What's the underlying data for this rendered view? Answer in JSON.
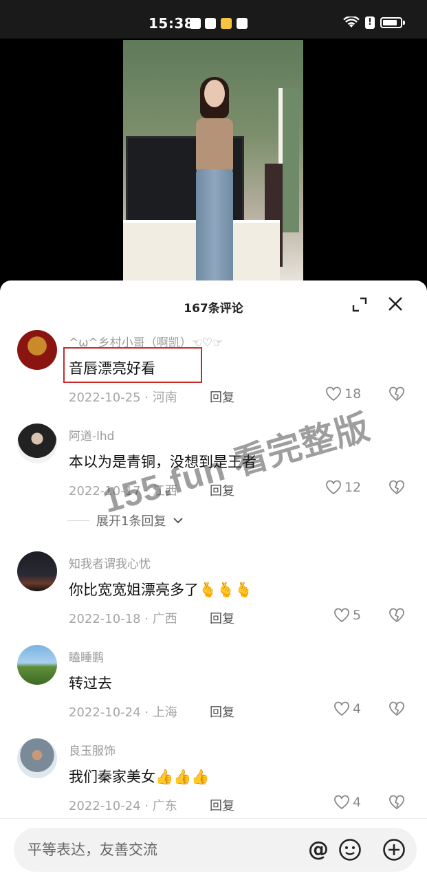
{
  "status_bar": {
    "time": "15:38"
  },
  "sheet": {
    "title": "167条评论"
  },
  "comments": [
    {
      "user": "^ω^乡村小哥（啊凯）☜♡☞",
      "text": "音唇漂亮好看",
      "date": "2022-10-25 · 河南",
      "reply": "回复",
      "likes": "18"
    },
    {
      "user": "阿道-lhd",
      "text": "本以为是青铜，没想到是王者",
      "date": "2022-10-17 · 江西",
      "reply": "回复",
      "likes": "12"
    },
    {
      "user": "知我者谓我心忧",
      "text": "你比宽宽姐漂亮多了🫰🫰🫰",
      "date": "2022-10-18 · 广西",
      "reply": "回复",
      "likes": "5"
    },
    {
      "user": "瞌睡鹏",
      "text": "转过去",
      "date": "2022-10-24 · 上海",
      "reply": "回复",
      "likes": "4"
    },
    {
      "user": "良玉服饰",
      "text": "我们秦家美女👍👍👍",
      "date": "2022-10-24 · 广东",
      "reply": "回复",
      "likes": "4"
    }
  ],
  "expand_replies": "展开1条回复",
  "watermark": "155.fun 看完整版",
  "input": {
    "placeholder": "平等表达，友善交流",
    "at_symbol": "@"
  },
  "colors": {
    "highlight": "#c82a2a",
    "sheet_bg": "#ffffff"
  }
}
